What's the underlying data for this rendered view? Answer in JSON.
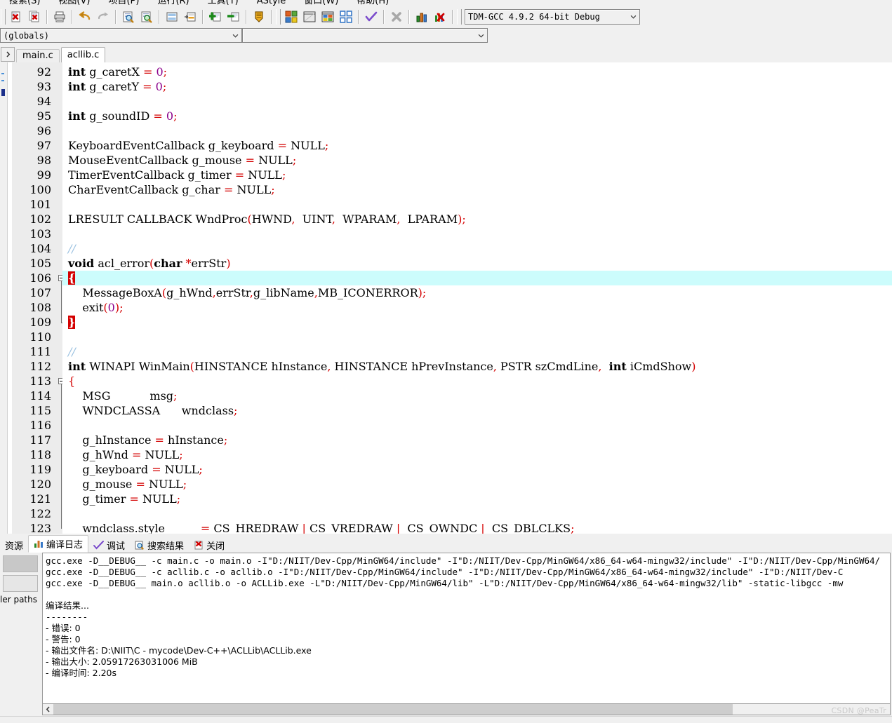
{
  "menu": {
    "items": [
      "搜索(S)",
      "视图(V)",
      "项目(P)",
      "运行(R)",
      "工具(T)",
      "AStyle",
      "窗口(W)",
      "帮助(H)"
    ]
  },
  "toolbar": {
    "buttons": [
      {
        "name": "close-file-button",
        "icon": "close-file-icon",
        "tooltip": "关闭"
      },
      {
        "name": "close-all-button",
        "icon": "close-all-icon",
        "tooltip": "全部关闭"
      },
      {
        "name": "print-button",
        "icon": "printer-icon",
        "tooltip": "打印"
      },
      {
        "name": "undo-button",
        "icon": "undo-arrow-icon",
        "tooltip": "撤销"
      },
      {
        "name": "redo-button",
        "icon": "redo-arrow-icon",
        "tooltip": "重做"
      },
      {
        "name": "find-button",
        "icon": "find-magnifier-icon",
        "tooltip": "查找"
      },
      {
        "name": "replace-button",
        "icon": "replace-magnifier-icon",
        "tooltip": "替换"
      },
      {
        "name": "goto-line-button",
        "icon": "goto-line-icon",
        "tooltip": "转到行"
      },
      {
        "name": "goto-function-button",
        "icon": "goto-function-icon",
        "tooltip": "转到函数"
      },
      {
        "name": "add-to-project-button",
        "icon": "plus-green-icon",
        "tooltip": "添加到工程"
      },
      {
        "name": "remove-from-project-button",
        "icon": "minus-green-icon",
        "tooltip": "从工程移除"
      },
      {
        "name": "project-options-button",
        "icon": "shield-icon",
        "tooltip": "工程属性"
      },
      {
        "name": "compile-button",
        "icon": "compile-blocks-icon",
        "tooltip": "编译"
      },
      {
        "name": "run-button",
        "icon": "run-window-icon",
        "tooltip": "运行"
      },
      {
        "name": "compile-run-button",
        "icon": "compile-run-icon",
        "tooltip": "编译运行"
      },
      {
        "name": "rebuild-all-button",
        "icon": "rebuild-all-icon",
        "tooltip": "全部重新编译"
      },
      {
        "name": "syntax-check-button",
        "icon": "checkmark-icon",
        "tooltip": "语法检查"
      },
      {
        "name": "stop-execution-button",
        "icon": "stop-x-icon",
        "tooltip": "停止执行"
      },
      {
        "name": "profile-button",
        "icon": "bar-chart-icon",
        "tooltip": "性能分析"
      },
      {
        "name": "delete-profile-button",
        "icon": "delete-profile-icon",
        "tooltip": "删除分析信息"
      }
    ],
    "compiler_select": {
      "value": "TDM-GCC 4.9.2 64-bit Debug",
      "icon": "chevron-down-icon"
    }
  },
  "browser_bar": {
    "scope_select": {
      "value": "(globals)",
      "icon": "chevron-down-icon"
    },
    "member_select": {
      "value": "",
      "icon": "chevron-down-icon"
    }
  },
  "editor_tabs": {
    "scroll_icon": "chevron-right-icon",
    "items": [
      {
        "label": "main.c",
        "active": false
      },
      {
        "label": "acllib.c",
        "active": true
      }
    ]
  },
  "editor": {
    "first_line": 92,
    "current_line": 106,
    "lines": [
      {
        "n": 92,
        "tokens": [
          {
            "t": "int",
            "c": "kw"
          },
          {
            "t": " g_caretX "
          },
          {
            "t": "=",
            "c": "pun"
          },
          {
            "t": " "
          },
          {
            "t": "0",
            "c": "num"
          },
          {
            "t": ";",
            "c": "pun"
          }
        ]
      },
      {
        "n": 93,
        "tokens": [
          {
            "t": "int",
            "c": "kw"
          },
          {
            "t": " g_caretY "
          },
          {
            "t": "=",
            "c": "pun"
          },
          {
            "t": " "
          },
          {
            "t": "0",
            "c": "num"
          },
          {
            "t": ";",
            "c": "pun"
          }
        ]
      },
      {
        "n": 94,
        "tokens": []
      },
      {
        "n": 95,
        "tokens": [
          {
            "t": "int",
            "c": "kw"
          },
          {
            "t": " g_soundID "
          },
          {
            "t": "=",
            "c": "pun"
          },
          {
            "t": " "
          },
          {
            "t": "0",
            "c": "num"
          },
          {
            "t": ";",
            "c": "pun"
          }
        ]
      },
      {
        "n": 96,
        "tokens": []
      },
      {
        "n": 97,
        "tokens": [
          {
            "t": "KeyboardEventCallback g_keyboard "
          },
          {
            "t": "=",
            "c": "pun"
          },
          {
            "t": " NULL"
          },
          {
            "t": ";",
            "c": "pun"
          }
        ]
      },
      {
        "n": 98,
        "tokens": [
          {
            "t": "MouseEventCallback g_mouse "
          },
          {
            "t": "=",
            "c": "pun"
          },
          {
            "t": " NULL"
          },
          {
            "t": ";",
            "c": "pun"
          }
        ]
      },
      {
        "n": 99,
        "tokens": [
          {
            "t": "TimerEventCallback g_timer "
          },
          {
            "t": "=",
            "c": "pun"
          },
          {
            "t": " NULL"
          },
          {
            "t": ";",
            "c": "pun"
          }
        ]
      },
      {
        "n": 100,
        "tokens": [
          {
            "t": "CharEventCallback g_char "
          },
          {
            "t": "=",
            "c": "pun"
          },
          {
            "t": " NULL"
          },
          {
            "t": ";",
            "c": "pun"
          }
        ]
      },
      {
        "n": 101,
        "tokens": []
      },
      {
        "n": 102,
        "tokens": [
          {
            "t": "LRESULT CALLBACK WndProc"
          },
          {
            "t": "(",
            "c": "pun"
          },
          {
            "t": "HWND"
          },
          {
            "t": ",",
            "c": "pun"
          },
          {
            "t": "  UINT"
          },
          {
            "t": ",",
            "c": "pun"
          },
          {
            "t": "  WPARAM"
          },
          {
            "t": ",",
            "c": "pun"
          },
          {
            "t": "  LPARAM"
          },
          {
            "t": ")",
            "c": "pun"
          },
          {
            "t": ";",
            "c": "pun"
          }
        ]
      },
      {
        "n": 103,
        "tokens": []
      },
      {
        "n": 104,
        "tokens": [
          {
            "t": "//",
            "c": "cmt"
          }
        ]
      },
      {
        "n": 105,
        "tokens": [
          {
            "t": "void",
            "c": "kw"
          },
          {
            "t": " acl_error"
          },
          {
            "t": "(",
            "c": "pun"
          },
          {
            "t": "char",
            "c": "kw"
          },
          {
            "t": " "
          },
          {
            "t": "*",
            "c": "pun"
          },
          {
            "t": "errStr"
          },
          {
            "t": ")",
            "c": "pun"
          }
        ]
      },
      {
        "n": 106,
        "tokens": [
          {
            "t": "{",
            "c": "brace"
          }
        ]
      },
      {
        "n": 107,
        "tokens": [
          {
            "t": "    MessageBoxA"
          },
          {
            "t": "(",
            "c": "pun"
          },
          {
            "t": "g_hWnd"
          },
          {
            "t": ",",
            "c": "pun"
          },
          {
            "t": "errStr"
          },
          {
            "t": ",",
            "c": "pun"
          },
          {
            "t": "g_libName"
          },
          {
            "t": ",",
            "c": "pun"
          },
          {
            "t": "MB_ICONERROR"
          },
          {
            "t": ")",
            "c": "pun"
          },
          {
            "t": ";",
            "c": "pun"
          }
        ]
      },
      {
        "n": 108,
        "tokens": [
          {
            "t": "    exit"
          },
          {
            "t": "(",
            "c": "pun"
          },
          {
            "t": "0",
            "c": "num"
          },
          {
            "t": ")",
            "c": "pun"
          },
          {
            "t": ";",
            "c": "pun"
          }
        ]
      },
      {
        "n": 109,
        "tokens": [
          {
            "t": "}",
            "c": "brace"
          }
        ]
      },
      {
        "n": 110,
        "tokens": []
      },
      {
        "n": 111,
        "tokens": [
          {
            "t": "//",
            "c": "cmt"
          }
        ]
      },
      {
        "n": 112,
        "tokens": [
          {
            "t": "int",
            "c": "kw"
          },
          {
            "t": " WINAPI WinMain"
          },
          {
            "t": "(",
            "c": "pun"
          },
          {
            "t": "HINSTANCE hInstance"
          },
          {
            "t": ",",
            "c": "pun"
          },
          {
            "t": " HINSTANCE hPrevInstance"
          },
          {
            "t": ",",
            "c": "pun"
          },
          {
            "t": " PSTR szCmdLine"
          },
          {
            "t": ",",
            "c": "pun"
          },
          {
            "t": "  "
          },
          {
            "t": "int",
            "c": "kw"
          },
          {
            "t": " iCmdShow"
          },
          {
            "t": ")",
            "c": "pun"
          }
        ]
      },
      {
        "n": 113,
        "tokens": [
          {
            "t": "{",
            "c": "pun"
          }
        ]
      },
      {
        "n": 114,
        "tokens": [
          {
            "t": "    MSG           msg"
          },
          {
            "t": ";",
            "c": "pun"
          }
        ]
      },
      {
        "n": 115,
        "tokens": [
          {
            "t": "    WNDCLASSA      wndclass"
          },
          {
            "t": ";",
            "c": "pun"
          }
        ]
      },
      {
        "n": 116,
        "tokens": []
      },
      {
        "n": 117,
        "tokens": [
          {
            "t": "    g_hInstance "
          },
          {
            "t": "=",
            "c": "pun"
          },
          {
            "t": " hInstance"
          },
          {
            "t": ";",
            "c": "pun"
          }
        ]
      },
      {
        "n": 118,
        "tokens": [
          {
            "t": "    g_hWnd "
          },
          {
            "t": "=",
            "c": "pun"
          },
          {
            "t": " NULL"
          },
          {
            "t": ";",
            "c": "pun"
          }
        ]
      },
      {
        "n": 119,
        "tokens": [
          {
            "t": "    g_keyboard "
          },
          {
            "t": "=",
            "c": "pun"
          },
          {
            "t": " NULL"
          },
          {
            "t": ";",
            "c": "pun"
          }
        ]
      },
      {
        "n": 120,
        "tokens": [
          {
            "t": "    g_mouse "
          },
          {
            "t": "=",
            "c": "pun"
          },
          {
            "t": " NULL"
          },
          {
            "t": ";",
            "c": "pun"
          }
        ]
      },
      {
        "n": 121,
        "tokens": [
          {
            "t": "    g_timer "
          },
          {
            "t": "=",
            "c": "pun"
          },
          {
            "t": " NULL"
          },
          {
            "t": ";",
            "c": "pun"
          }
        ]
      },
      {
        "n": 122,
        "tokens": []
      },
      {
        "n": 123,
        "tokens": [
          {
            "t": "    wndclass.style          "
          },
          {
            "t": "=",
            "c": "pun"
          },
          {
            "t": " CS_HREDRAW "
          },
          {
            "t": "|",
            "c": "pun"
          },
          {
            "t": " CS_VREDRAW "
          },
          {
            "t": "|",
            "c": "pun"
          },
          {
            "t": "  CS_OWNDC "
          },
          {
            "t": "|",
            "c": "pun"
          },
          {
            "t": "  CS_DBLCLKS"
          },
          {
            "t": ";",
            "c": "pun"
          }
        ]
      }
    ]
  },
  "bottom_panel": {
    "tabs": [
      {
        "label": "资源",
        "icon": "",
        "active": false,
        "name": "tab-resources"
      },
      {
        "label": "编译日志",
        "icon": "compile-log-icon",
        "active": true,
        "name": "tab-compile-log"
      },
      {
        "label": "调试",
        "icon": "debug-check-icon",
        "active": false,
        "name": "tab-debug"
      },
      {
        "label": "搜索结果",
        "icon": "search-results-icon",
        "active": false,
        "name": "tab-search-results"
      },
      {
        "label": "关闭",
        "icon": "close-panel-icon",
        "active": false,
        "name": "tab-close"
      }
    ],
    "side_label": "ler paths",
    "log": [
      "gcc.exe -D__DEBUG__ -c main.c -o main.o -I\"D:/NIIT/Dev-Cpp/MinGW64/include\" -I\"D:/NIIT/Dev-Cpp/MinGW64/x86_64-w64-mingw32/include\" -I\"D:/NIIT/Dev-Cpp/MinGW64/",
      "gcc.exe -D__DEBUG__ -c acllib.c -o acllib.o -I\"D:/NIIT/Dev-Cpp/MinGW64/include\" -I\"D:/NIIT/Dev-Cpp/MinGW64/x86_64-w64-mingw32/include\" -I\"D:/NIIT/Dev-C",
      "gcc.exe -D__DEBUG__ main.o acllib.o -o ACLLib.exe -L\"D:/NIIT/Dev-Cpp/MinGW64/lib\" -L\"D:/NIIT/Dev-Cpp/MinGW64/x86_64-w64-mingw32/lib\" -static-libgcc -mw",
      "",
      "编译结果...",
      "--------",
      "- 错误: 0",
      "- 警告: 0",
      "- 输出文件名: D:\\NIIT\\C - mycode\\Dev-C++\\ACLLib\\ACLLib.exe",
      "- 输出大小: 2.05917263031006 MiB",
      "- 编译时间: 2.20s"
    ]
  },
  "scrollbar": {
    "left_icon": "chevron-left-icon",
    "thumb_percent": 82
  },
  "watermark": "CSDN @PeaTr",
  "colors": {
    "highlight_line": "#ccfcfc",
    "brace_match_bg": "#d40000",
    "punctuation": "#d40000",
    "number": "#8b008b",
    "comment": "#99c0e0",
    "editor_bg": "#ffffff",
    "chrome_bg": "#f0f0f0"
  }
}
